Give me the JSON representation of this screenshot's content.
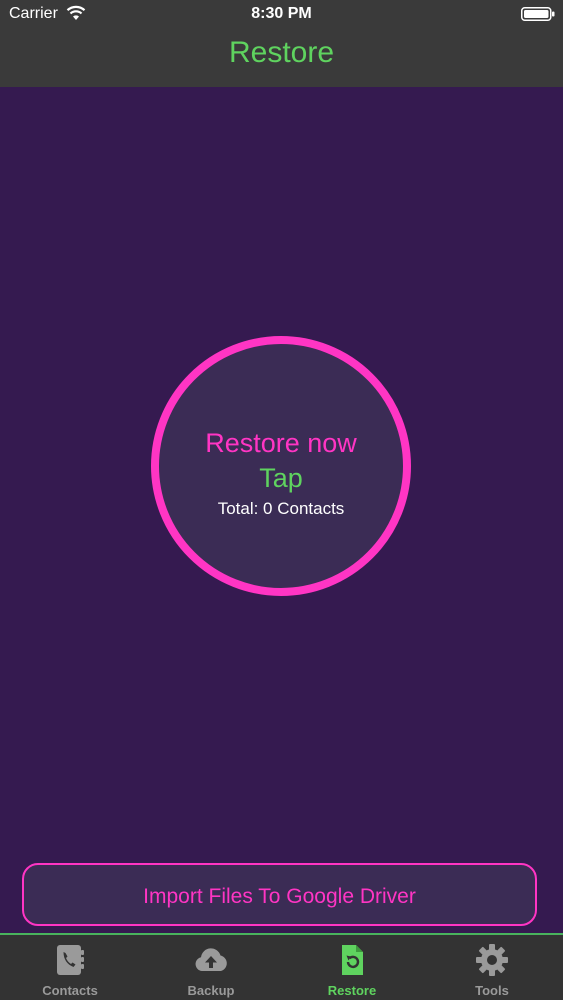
{
  "status_bar": {
    "carrier": "Carrier",
    "time": "8:30 PM"
  },
  "nav": {
    "title": "Restore"
  },
  "restore": {
    "action_label": "Restore now",
    "tap_label": "Tap",
    "total_label": "Total: 0 Contacts"
  },
  "import_button": {
    "label": "Import Files To Google Driver"
  },
  "tabs": [
    {
      "label": "Contacts",
      "icon": "contacts-book-icon",
      "active": false
    },
    {
      "label": "Backup",
      "icon": "cloud-upload-icon",
      "active": false
    },
    {
      "label": "Restore",
      "icon": "restore-file-icon",
      "active": true
    },
    {
      "label": "Tools",
      "icon": "gear-icon",
      "active": false
    }
  ],
  "colors": {
    "background": "#351a50",
    "bar": "#3a3a3a",
    "accent_pink": "#ff35c4",
    "accent_green": "#5fd35f",
    "tab_inactive": "#9a9a9a"
  }
}
